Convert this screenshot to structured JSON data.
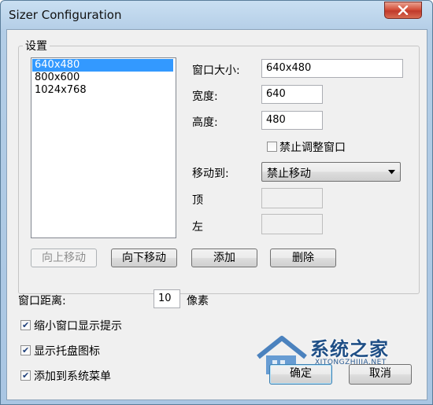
{
  "window": {
    "title": "Sizer Configuration"
  },
  "settings_group": {
    "label": "设置",
    "sizes": [
      {
        "label": "640x480",
        "selected": true
      },
      {
        "label": "800x600",
        "selected": false
      },
      {
        "label": "1024x768",
        "selected": false
      }
    ],
    "window_size_label": "窗口大小:",
    "window_size_value": "640x480",
    "width_label": "宽度:",
    "width_value": "640",
    "height_label": "高度:",
    "height_value": "480",
    "disable_resize_label": "禁止调整窗口",
    "disable_resize_checked": false,
    "move_to_label": "移动到:",
    "move_to_value": "禁止移动",
    "top_label": "顶",
    "top_value": "",
    "left_label": "左",
    "left_value": "",
    "move_up_button": "向上移动",
    "move_down_button": "向下移动",
    "add_button": "添加",
    "delete_button": "删除"
  },
  "window_distance": {
    "label": "窗口距离:",
    "value": "10",
    "unit": "像素"
  },
  "options": {
    "show_tooltip_label": "缩小窗口显示提示",
    "show_tooltip_checked": true,
    "show_tray_icon_label": "显示托盘图标",
    "show_tray_icon_checked": true,
    "add_to_menu_label": "添加到系统菜单",
    "add_to_menu_checked": true
  },
  "footer": {
    "ok_button": "确定",
    "cancel_button": "取消"
  },
  "watermark": {
    "name": "系统之家",
    "url": "XITONGZHIJIA.NET"
  },
  "colors": {
    "selection": "#3399ff",
    "close_button": "#c0392b",
    "title_bar": "#b3cde6"
  }
}
